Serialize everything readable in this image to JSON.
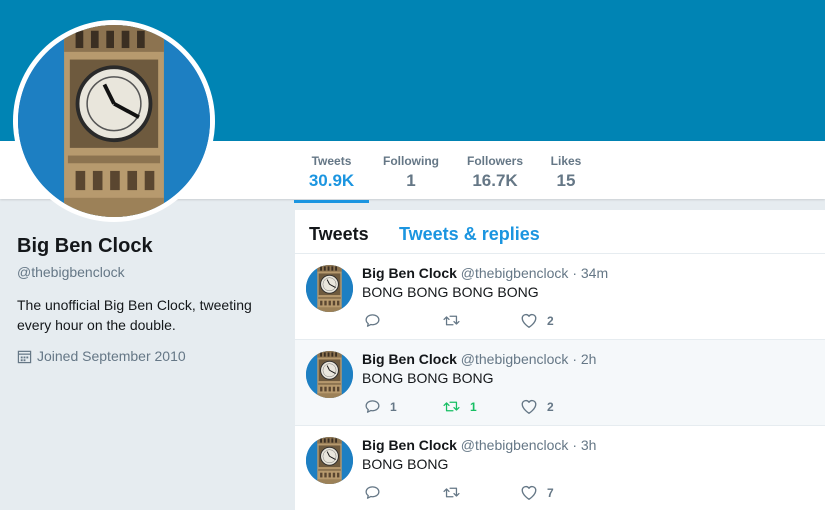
{
  "profile": {
    "name": "Big Ben Clock",
    "handle": "@thebigbenclock",
    "bio": "The unofficial Big Ben Clock, tweeting every hour on the double.",
    "joined": "Joined September 2010"
  },
  "stats": {
    "tweets": {
      "label": "Tweets",
      "value": "30.9K"
    },
    "following": {
      "label": "Following",
      "value": "1"
    },
    "followers": {
      "label": "Followers",
      "value": "16.7K"
    },
    "likes": {
      "label": "Likes",
      "value": "15"
    }
  },
  "tabs": {
    "tweets": "Tweets",
    "replies": "Tweets & replies"
  },
  "tweets": [
    {
      "name": "Big Ben Clock",
      "handle": "@thebigbenclock",
      "dot": "·",
      "time": "34m",
      "text": "BONG BONG BONG BONG",
      "replies": "",
      "retweets": "",
      "likes": "2"
    },
    {
      "name": "Big Ben Clock",
      "handle": "@thebigbenclock",
      "dot": "·",
      "time": "2h",
      "text": "BONG BONG BONG",
      "replies": "1",
      "retweets": "1",
      "likes": "2"
    },
    {
      "name": "Big Ben Clock",
      "handle": "@thebigbenclock",
      "dot": "·",
      "time": "3h",
      "text": "BONG BONG",
      "replies": "",
      "retweets": "",
      "likes": "7"
    }
  ],
  "colors": {
    "banner": "#0084b4",
    "accent": "#1b95e0",
    "retweeted": "#17bf63",
    "muted": "#657786"
  },
  "icons": {
    "calendar": "calendar-icon",
    "reply": "reply-icon",
    "retweet": "retweet-icon",
    "like": "heart-icon"
  }
}
